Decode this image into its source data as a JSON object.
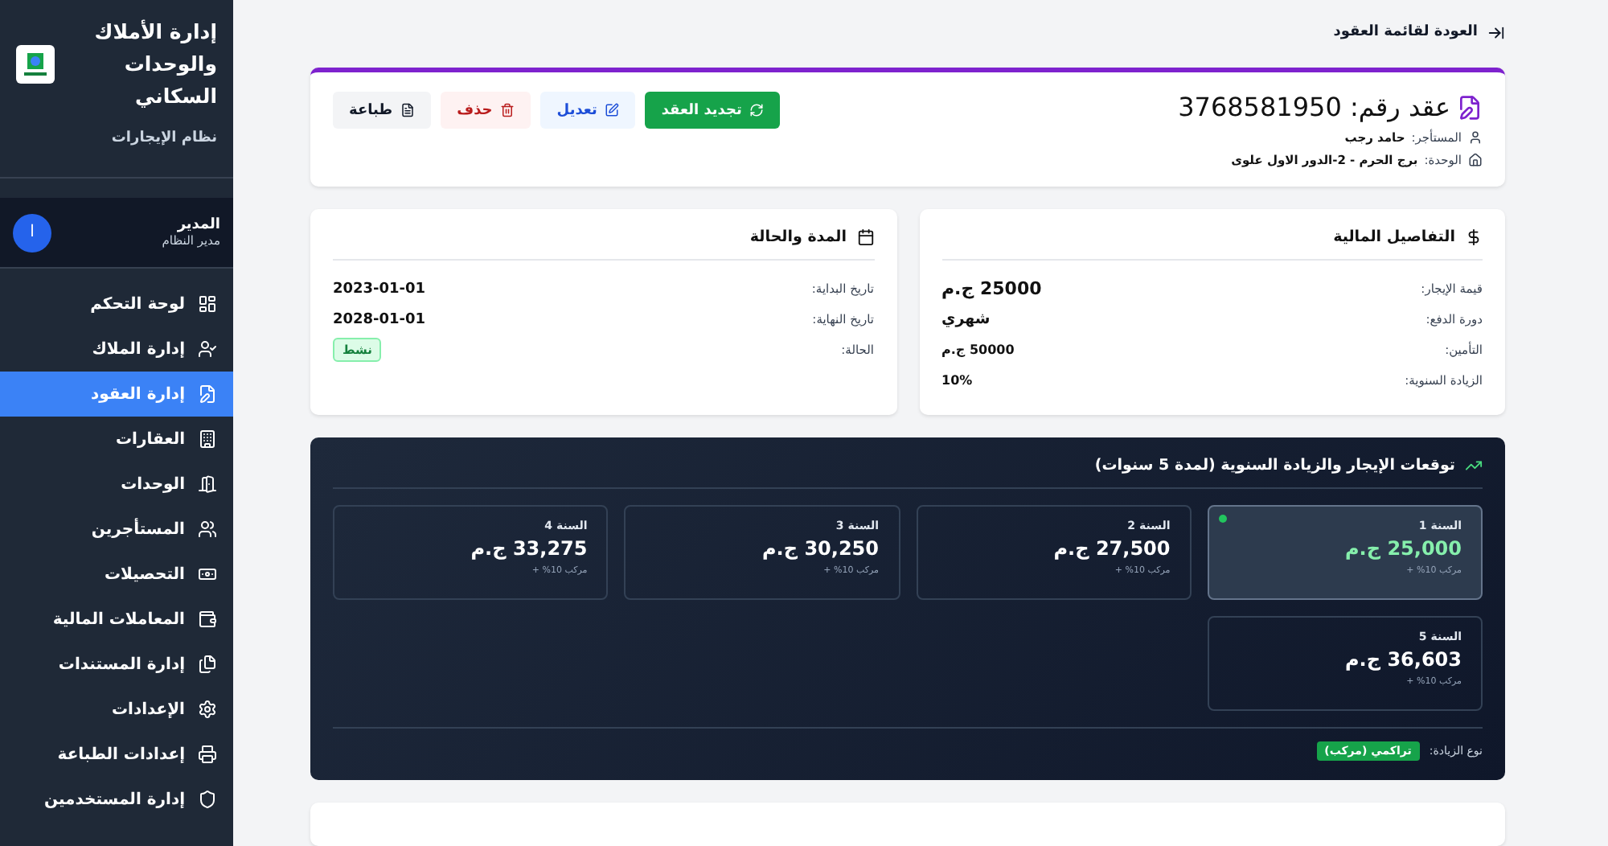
{
  "sidebar": {
    "title": "إدارة الأملاك والوحدات السكاني",
    "subtitle": "نظام الإيجارات",
    "user": {
      "initial": "ا",
      "name": "المدير",
      "role": "مدير النظام"
    },
    "items": [
      {
        "label": "لوحة التحكم",
        "selected": false
      },
      {
        "label": "إدارة الملاك",
        "selected": false
      },
      {
        "label": "إدارة العقود",
        "selected": true
      },
      {
        "label": "العقارات",
        "selected": false
      },
      {
        "label": "الوحدات",
        "selected": false
      },
      {
        "label": "المستأجرين",
        "selected": false
      },
      {
        "label": "التحصيلات",
        "selected": false
      },
      {
        "label": "المعاملات المالية",
        "selected": false
      },
      {
        "label": "إدارة المستندات",
        "selected": false
      },
      {
        "label": "الإعدادات",
        "selected": false
      },
      {
        "label": "إعدادات الطباعة",
        "selected": false
      },
      {
        "label": "إدارة المستخدمين",
        "selected": false
      }
    ]
  },
  "back_link": "العودة لقائمة العقود",
  "contract": {
    "title": "عقد رقم: 3768581950",
    "tenant_label": "المستأجر:",
    "tenant": "حامد رجب",
    "unit_label": "الوحدة:",
    "unit": "برج الحرم - 2-الدور الاول علوى",
    "buttons": [
      {
        "label": "تجديد العقد",
        "kind": "renew"
      },
      {
        "label": "تعديل",
        "kind": "edit"
      },
      {
        "label": "حذف",
        "kind": "delete"
      },
      {
        "label": "طباعة",
        "kind": "print"
      }
    ]
  },
  "financial": {
    "title": "التفاصيل المالية",
    "rows": [
      {
        "label": "قيمة الإيجار:",
        "value": "25000 ج.م",
        "kind": "large"
      },
      {
        "label": "دورة الدفع:",
        "value": "شهري",
        "kind": "medium"
      },
      {
        "label": "التأمين:",
        "value": "50000 ج.م",
        "kind": "small"
      },
      {
        "label": "الزيادة السنوية:",
        "value": "10%",
        "kind": "small"
      }
    ]
  },
  "duration": {
    "title": "المدة والحالة",
    "rows": [
      {
        "label": "تاريخ البداية:",
        "value": "2023-01-01",
        "kind": "date"
      },
      {
        "label": "تاريخ النهاية:",
        "value": "2028-01-01",
        "kind": "date"
      },
      {
        "label": "الحالة:",
        "value": "نشط",
        "kind": "status"
      }
    ]
  },
  "projection": {
    "title": "توقعات الإيجار والزيادة السنوية (لمدة 5 سنوات)",
    "years": [
      {
        "label": "السنة 1",
        "amount": "25,000 ج.م",
        "note": "مركب 10% +",
        "selected": true
      },
      {
        "label": "السنة 2",
        "amount": "27,500 ج.م",
        "note": "مركب 10% +",
        "selected": false
      },
      {
        "label": "السنة 3",
        "amount": "30,250 ج.م",
        "note": "مركب 10% +",
        "selected": false
      },
      {
        "label": "السنة 4",
        "amount": "33,275 ج.م",
        "note": "مركب 10% +",
        "selected": false
      },
      {
        "label": "السنة 5",
        "amount": "36,603 ج.م",
        "note": "مركب 10% +",
        "selected": false
      }
    ],
    "increase_label": "نوع الزيادة:",
    "increase_type": "تراكمي (مركب)"
  }
}
